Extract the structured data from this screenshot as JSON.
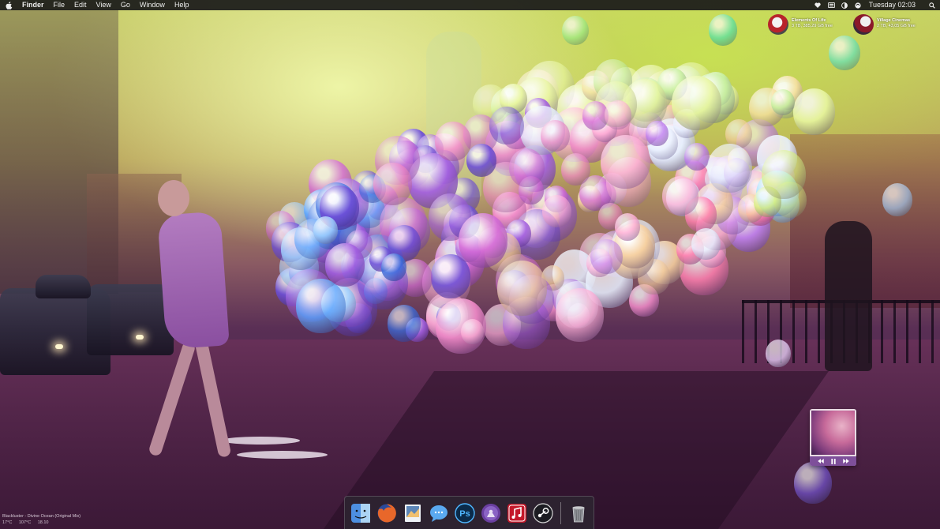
{
  "menubar": {
    "app_name": "Finder",
    "menus": [
      "File",
      "Edit",
      "View",
      "Go",
      "Window",
      "Help"
    ],
    "status_icons": [
      "heart-icon",
      "keyboard-icon",
      "contrast-icon",
      "sync-icon",
      "search-icon"
    ],
    "clock": "Tuesday 02:03"
  },
  "drives": [
    {
      "name": "Elements Of Life",
      "info": "3 TB, 385,29 GB free",
      "color": "#b8232b"
    },
    {
      "name": "Village Cinemas",
      "info": "2 TB, 43,05 GB free",
      "color": "#8a1a2a"
    }
  ],
  "now_playing": {
    "track": "Blackluster - Divine Ocean (Original Mix)",
    "stats": [
      "17°C",
      "107°C",
      "18.10"
    ]
  },
  "music_widget": {
    "controls": [
      "previous-icon",
      "pause-icon",
      "next-icon"
    ]
  },
  "dock": {
    "apps": [
      {
        "icon": "finder-icon",
        "color": "#4d8fe0"
      },
      {
        "icon": "firefox-icon",
        "color": "#e8672a"
      },
      {
        "icon": "preview-icon",
        "color": "#5d86b8"
      },
      {
        "icon": "messages-icon",
        "color": "#5aa9f0"
      },
      {
        "icon": "photoshop-icon",
        "color": "#0b2b4a"
      },
      {
        "icon": "alfred-icon",
        "color": "#6a3fa0"
      },
      {
        "icon": "itunes-icon",
        "color": "#c4182a"
      },
      {
        "icon": "steam-icon",
        "color": "#1c1c22"
      }
    ],
    "trash_icon": "trash-icon"
  }
}
